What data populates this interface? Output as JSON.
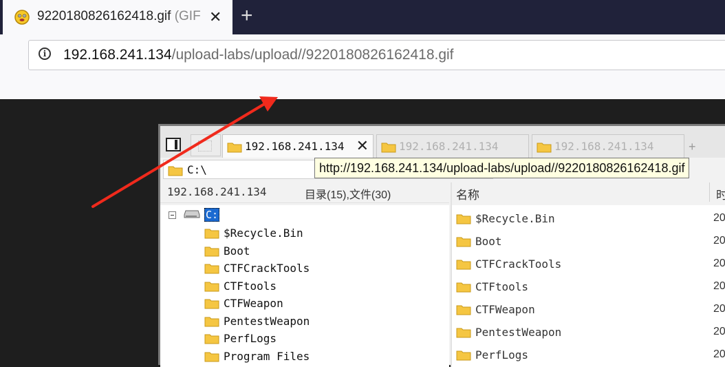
{
  "browser": {
    "tab_title": "9220180826162418.gif",
    "tab_mime": "(GIF",
    "new_tab_symbol": "+",
    "url_host": "192.168.241.134",
    "url_path": "/upload-labs/upload//9220180826162418.gif"
  },
  "explorer": {
    "tabs": [
      {
        "label": "192.168.241.134"
      },
      {
        "label": "192.168.241.134"
      },
      {
        "label": "192.168.241.134"
      }
    ],
    "add_tab_symbol": "+",
    "address": "C:\\",
    "tooltip": "http://192.168.241.134/upload-labs/upload//9220180826162418.gif",
    "left_header_host": "192.168.241.134",
    "left_header_count": "目录(15),文件(30)",
    "right_header_name": "名称",
    "right_header_time": "时",
    "drive_label": "C:",
    "tree_items": [
      "$Recycle.Bin",
      "Boot",
      "CTFCrackTools",
      "CTFtools",
      "CTFWeapon",
      "PentestWeapon",
      "PerfLogs",
      "Program Files"
    ],
    "list_items": [
      {
        "name": "$Recycle.Bin",
        "date": "20"
      },
      {
        "name": "Boot",
        "date": "20"
      },
      {
        "name": "CTFCrackTools",
        "date": "20"
      },
      {
        "name": "CTFtools",
        "date": "20"
      },
      {
        "name": "CTFWeapon",
        "date": "20"
      },
      {
        "name": "PentestWeapon",
        "date": "20"
      },
      {
        "name": "PerfLogs",
        "date": "20"
      }
    ]
  },
  "colors": {
    "arrow": "#f02a1c",
    "folder": "#f5c642",
    "selection": "#1b6ad1"
  }
}
